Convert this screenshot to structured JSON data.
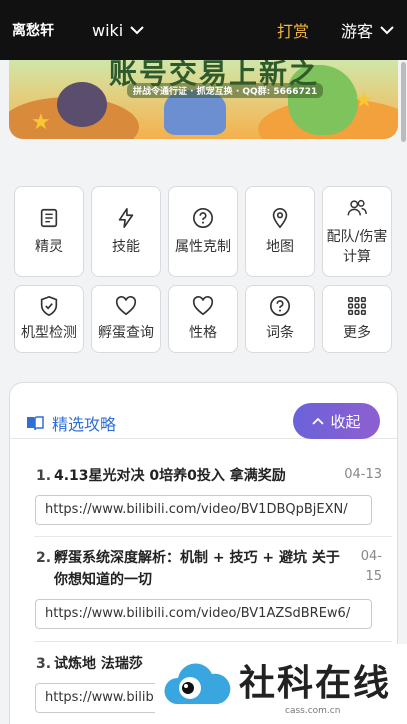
{
  "topbar": {
    "brand": "离愁轩",
    "wiki": "wiki",
    "reward": "打赏",
    "guest": "游客"
  },
  "banner": {
    "title": "账号交易上新之",
    "subtitle": "拼战令通行证 · 抓宠互换 · QQ群: 5666721"
  },
  "features": [
    {
      "label": "精灵",
      "icon": "book-icon"
    },
    {
      "label": "技能",
      "icon": "lightning-icon"
    },
    {
      "label": "属性克制",
      "icon": "question-icon"
    },
    {
      "label": "地图",
      "icon": "location-pin-icon"
    },
    {
      "label": "配队/伤害计算",
      "icon": "people-icon"
    },
    {
      "label": "机型检测",
      "icon": "shield-check-icon"
    },
    {
      "label": "孵蛋查询",
      "icon": "heart-icon"
    },
    {
      "label": "性格",
      "icon": "heart-icon"
    },
    {
      "label": "词条",
      "icon": "question-icon"
    },
    {
      "label": "更多",
      "icon": "grid-icon"
    }
  ],
  "guides": {
    "title": "精选攻略",
    "collapse_label": "收起",
    "items": [
      {
        "num": "1.",
        "title": "4.13星光对决 0培养0投入 拿满奖励",
        "date": "04-13",
        "url": "https://www.bilibili.com/video/BV1DBQpBjEXN/"
      },
      {
        "num": "2.",
        "title": "孵蛋系统深度解析：机制 + 技巧 + 避坑 关于你想知道的一切",
        "date": "04-15",
        "url": "https://www.bilibili.com/video/BV1AZSdBREw6/"
      },
      {
        "num": "3.",
        "title": "试炼地 法瑞莎",
        "date": "",
        "url": "https://www.bilibili.com/video/"
      }
    ]
  },
  "watermark": {
    "text": "社科在线",
    "domain": "cass.com.cn"
  },
  "colors": {
    "topbar_bg": "#111111",
    "reward": "#f0b43a",
    "accent_blue": "#2f6fd6",
    "collapse_gradient_start": "#6b62d9",
    "collapse_gradient_end": "#8e5fd0"
  }
}
